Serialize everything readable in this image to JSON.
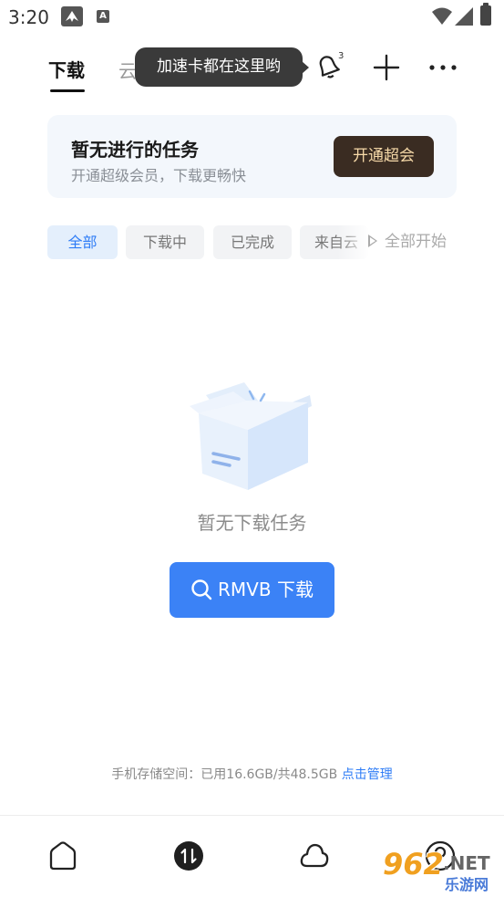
{
  "status_bar": {
    "time": "3:20",
    "app_icon_2": "A"
  },
  "header": {
    "tab_download": "下载",
    "tab_cloud": "云添",
    "tooltip": "加速卡都在这里哟",
    "bell_badge": "3"
  },
  "promo": {
    "title": "暂无进行的任务",
    "subtitle": "开通超级会员，下载更畅快",
    "button": "开通超会"
  },
  "filters": {
    "items": [
      "全部",
      "下载中",
      "已完成",
      "来自云"
    ],
    "active_index": 0,
    "start_all": "全部开始"
  },
  "empty": {
    "text": "暂无下载任务",
    "button": "RMVB 下载"
  },
  "storage": {
    "label": "手机存储空间：已用16.6GB/共48.5GB",
    "manage": "点击管理"
  },
  "watermark": {
    "number": "962",
    "net": ".NET",
    "site": "乐游网"
  },
  "colors": {
    "accent": "#3b82f6",
    "promo_button_bg": "#3a2c22",
    "promo_button_text": "#f6d9a8"
  },
  "icons": [
    "bell-icon",
    "plus-icon",
    "more-icon",
    "play-icon",
    "search-icon",
    "home-icon",
    "transfer-icon",
    "cloud-icon",
    "profile-icon"
  ]
}
